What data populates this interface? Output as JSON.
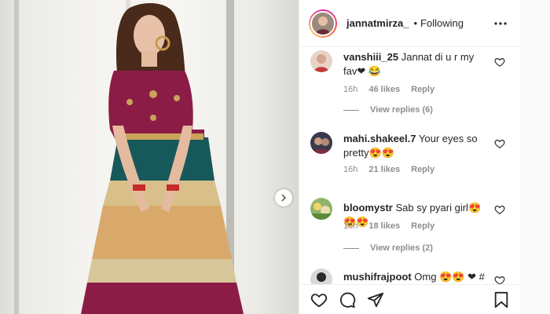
{
  "header": {
    "username": "jannatmirza_",
    "dot": "•",
    "follow_state": "Following",
    "more_icon": "more-horizontal-icon"
  },
  "media": {
    "next_icon": "chevron-right-icon"
  },
  "comments": [
    {
      "username": "vanshiii_25",
      "text": "Jannat di u r my fav❤ 😂",
      "age": "16h",
      "likes": "46 likes",
      "reply": "Reply",
      "view_replies": "View replies (6)"
    },
    {
      "username": "mahi.shakeel.7",
      "text": "Your eyes so pretty😍😍",
      "age": "16h",
      "likes": "21 likes",
      "reply": "Reply",
      "view_replies": ""
    },
    {
      "username": "bloomystr",
      "text": "Sab sy pyari girl😍😍😍",
      "age": "16h",
      "likes": "18 likes",
      "reply": "Reply",
      "view_replies": "View replies (2)"
    },
    {
      "username": "mushifrajpoot",
      "text": "Omg 😍😍 ❤ #",
      "age": "",
      "likes": "",
      "reply": "",
      "view_replies": ""
    }
  ],
  "actions": {
    "like_icon": "heart-icon",
    "comment_icon": "comment-icon",
    "share_icon": "paper-plane-icon",
    "save_icon": "bookmark-icon"
  },
  "colors": {
    "text": "#262626",
    "muted": "#8e8e8e",
    "border": "#efefef",
    "blouse": "#8b1c46",
    "teal": "#17585a",
    "gold": "#d9a96b"
  }
}
